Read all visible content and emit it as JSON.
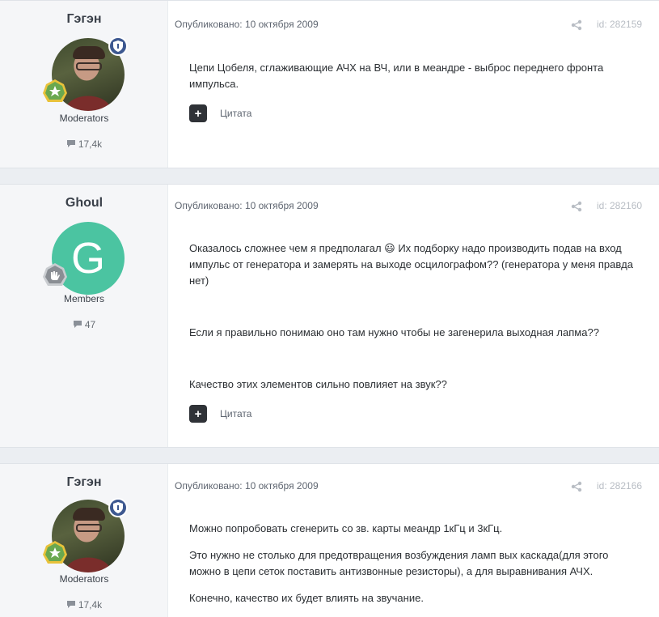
{
  "posts": [
    {
      "author": "Гэгэн",
      "role": "Moderators",
      "post_count": "17,4k",
      "date_label": "Опубликовано: 10 октября 2009",
      "post_id": "id: 282159",
      "paragraphs": [
        "Цепи Цобеля, сглаживающие АЧХ на ВЧ, или в меандре - выброс переднего фронта импульса."
      ],
      "quote_label": "Цитата"
    },
    {
      "author": "Ghoul",
      "avatar_letter": "G",
      "role": "Members",
      "post_count": "47",
      "date_label": "Опубликовано: 10 октября 2009",
      "post_id": "id: 282160",
      "paragraphs": [
        "Оказалось сложнее чем я предполагал 😃 Их подборку надо производить подав на вход импульс от генератора и замерять на выходе осцилографом?? (генератора у меня правда нет)",
        "Если я правильно понимаю оно там нужно чтобы не загенерила выходная лапма??",
        "Качество этих элементов сильно повлияет на звук??"
      ],
      "quote_label": "Цитата"
    },
    {
      "author": "Гэгэн",
      "role": "Moderators",
      "post_count": "17,4k",
      "date_label": "Опубликовано: 10 октября 2009",
      "post_id": "id: 282166",
      "paragraphs": [
        "Можно попробовать сгенерить со зв. карты меандр 1кГц и 3кГц.",
        "Это нужно не столько для предотвращения возбуждения ламп вых каскада(для этого можно в цепи сеток поставить антизвонные резисторы), а для выравнивания АЧХ.",
        "Конечно, качество их будет влиять на звучание."
      ]
    }
  ],
  "icons": {
    "share": "share-icon",
    "comment": "comment-icon",
    "moderator": "shield-icon",
    "rank": "rank-star-icon"
  },
  "colors": {
    "page_bg": "#ebeef2",
    "author_bg": "#f5f6f8",
    "avatar_g": "#4bc4a1",
    "mod_badge": "#3d5890",
    "rank_green": "#6aa84f",
    "rank_gold": "#e8c23a"
  }
}
